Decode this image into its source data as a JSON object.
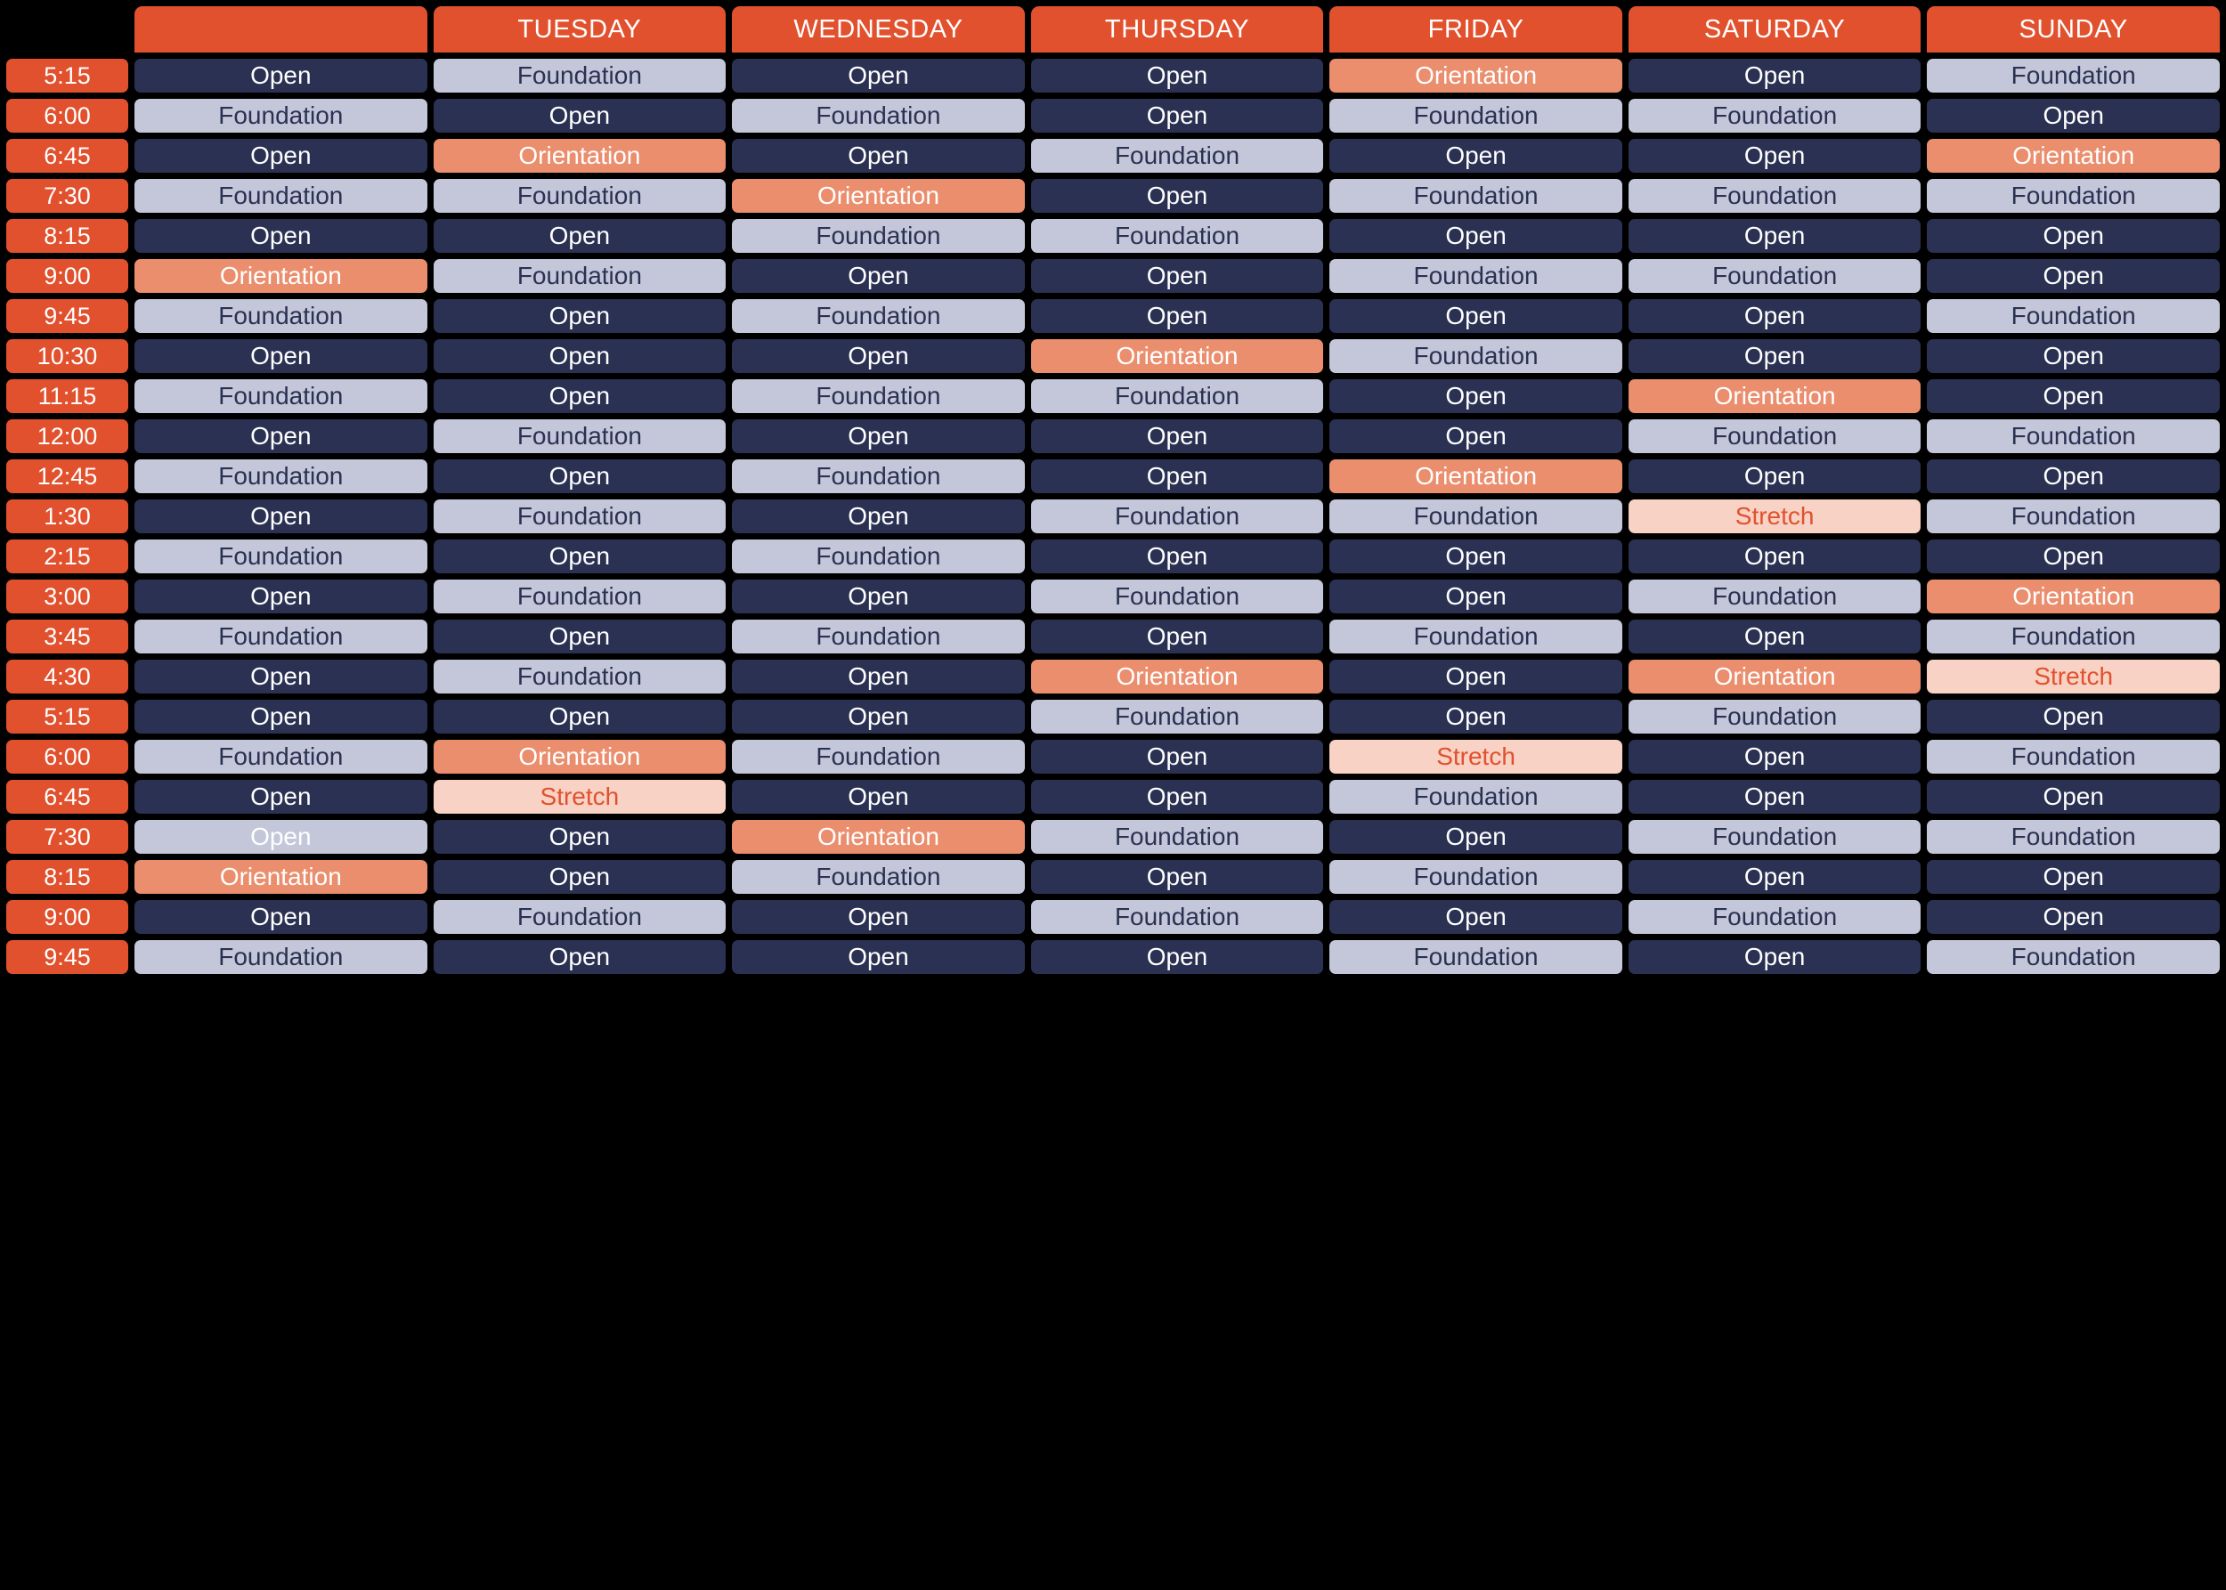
{
  "grid": {
    "corner_label": "",
    "day_headers": [
      "",
      "TUESDAY",
      "WEDNESDAY",
      "THURSDAY",
      "FRIDAY",
      "SATURDAY",
      "SUNDAY"
    ],
    "times": [
      "5:15",
      "6:00",
      "6:45",
      "7:30",
      "8:15",
      "9:00",
      "9:45",
      "10:30",
      "11:15",
      "12:00",
      "12:45",
      "1:30",
      "2:15",
      "3:00",
      "3:45",
      "4:30",
      "5:15",
      "6:00",
      "6:45",
      "7:30",
      "8:15",
      "9:00",
      "9:45"
    ],
    "class_types": {
      "open": "Open",
      "foundation": "Foundation",
      "orientation": "Orientation",
      "stretch": "Stretch"
    },
    "colors": {
      "accent_orange": "#E1512E",
      "open_bg": "#2B3152",
      "open_text": "#FFFFFF",
      "foundation_bg": "#C3C7D9",
      "foundation_text": "#2B3152",
      "orientation_bg": "#EA8E6E",
      "orientation_text": "#FFFFFF",
      "stretch_bg": "#F8D2C4",
      "stretch_text": "#E1512E",
      "page_bg": "#000000"
    },
    "rows": [
      {
        "time": "5:15",
        "cells": [
          "Open",
          "Foundation",
          "Open",
          "Open",
          "Orientation",
          "Open",
          "Foundation"
        ]
      },
      {
        "time": "6:00",
        "cells": [
          "Foundation",
          "Open",
          "Foundation",
          "Open",
          "Foundation",
          "Foundation",
          "Open"
        ]
      },
      {
        "time": "6:45",
        "cells": [
          "Open",
          "Orientation",
          "Open",
          "Foundation",
          "Open",
          "Open",
          "Orientation"
        ]
      },
      {
        "time": "7:30",
        "cells": [
          "Foundation",
          "Foundation",
          "Orientation",
          "Open",
          "Foundation",
          "Foundation",
          "Foundation"
        ]
      },
      {
        "time": "8:15",
        "cells": [
          "Open",
          "Open",
          "Foundation",
          "Foundation",
          "Open",
          "Open",
          "Open"
        ]
      },
      {
        "time": "9:00",
        "cells": [
          "Orientation",
          "Foundation",
          "Open",
          "Open",
          "Foundation",
          "Foundation",
          "Open"
        ]
      },
      {
        "time": "9:45",
        "cells": [
          "Foundation",
          "Open",
          "Foundation",
          "Open",
          "Open",
          "Open",
          "Foundation"
        ]
      },
      {
        "time": "10:30",
        "cells": [
          "Open",
          "Open",
          "Open",
          "Orientation",
          "Foundation",
          "Open",
          "Open"
        ]
      },
      {
        "time": "11:15",
        "cells": [
          "Foundation",
          "Open",
          "Foundation",
          "Foundation",
          "Open",
          "Orientation",
          "Open"
        ]
      },
      {
        "time": "12:00",
        "cells": [
          "Open",
          "Foundation",
          "Open",
          "Open",
          "Open",
          "Foundation",
          "Foundation"
        ]
      },
      {
        "time": "12:45",
        "cells": [
          "Foundation",
          "Open",
          "Foundation",
          "Open",
          "Orientation",
          "Open",
          "Open"
        ]
      },
      {
        "time": "1:30",
        "cells": [
          "Open",
          "Foundation",
          "Open",
          "Foundation",
          "Foundation",
          "Stretch",
          "Foundation"
        ]
      },
      {
        "time": "2:15",
        "cells": [
          "Foundation",
          "Open",
          "Foundation",
          "Open",
          "Open",
          "Open",
          "Open"
        ]
      },
      {
        "time": "3:00",
        "cells": [
          "Open",
          "Foundation",
          "Open",
          "Foundation",
          "Open",
          "Foundation",
          "Orientation"
        ]
      },
      {
        "time": "3:45",
        "cells": [
          "Foundation",
          "Open",
          "Foundation",
          "Open",
          "Foundation",
          "Open",
          "Foundation"
        ]
      },
      {
        "time": "4:30",
        "cells": [
          "Open",
          "Foundation",
          "Open",
          "Orientation",
          "Open",
          "Orientation",
          "Stretch"
        ]
      },
      {
        "time": "5:15",
        "cells": [
          "Open",
          "Open",
          "Open",
          "Foundation",
          "Open",
          "Foundation",
          "Open"
        ]
      },
      {
        "time": "6:00",
        "cells": [
          "Foundation",
          "Orientation",
          "Foundation",
          "Open",
          "Stretch",
          "Open",
          "Foundation"
        ]
      },
      {
        "time": "6:45",
        "cells": [
          "Open",
          "Stretch",
          "Open",
          "Open",
          "Foundation",
          "Open",
          "Open"
        ]
      },
      {
        "time": "7:30",
        "cells": [
          "Open",
          "Open",
          "Orientation",
          "Foundation",
          "Open",
          "Foundation",
          "Foundation"
        ]
      },
      {
        "time": "8:15",
        "cells": [
          "Orientation",
          "Open",
          "Foundation",
          "Open",
          "Foundation",
          "Open",
          "Open"
        ]
      },
      {
        "time": "9:00",
        "cells": [
          "Open",
          "Foundation",
          "Open",
          "Foundation",
          "Open",
          "Foundation",
          "Open"
        ]
      },
      {
        "time": "9:45",
        "cells": [
          "Foundation",
          "Open",
          "Open",
          "Open",
          "Foundation",
          "Open",
          "Foundation"
        ]
      }
    ],
    "special_styles": [
      {
        "row": 19,
        "col": 0,
        "note": "light-bg"
      }
    ]
  }
}
